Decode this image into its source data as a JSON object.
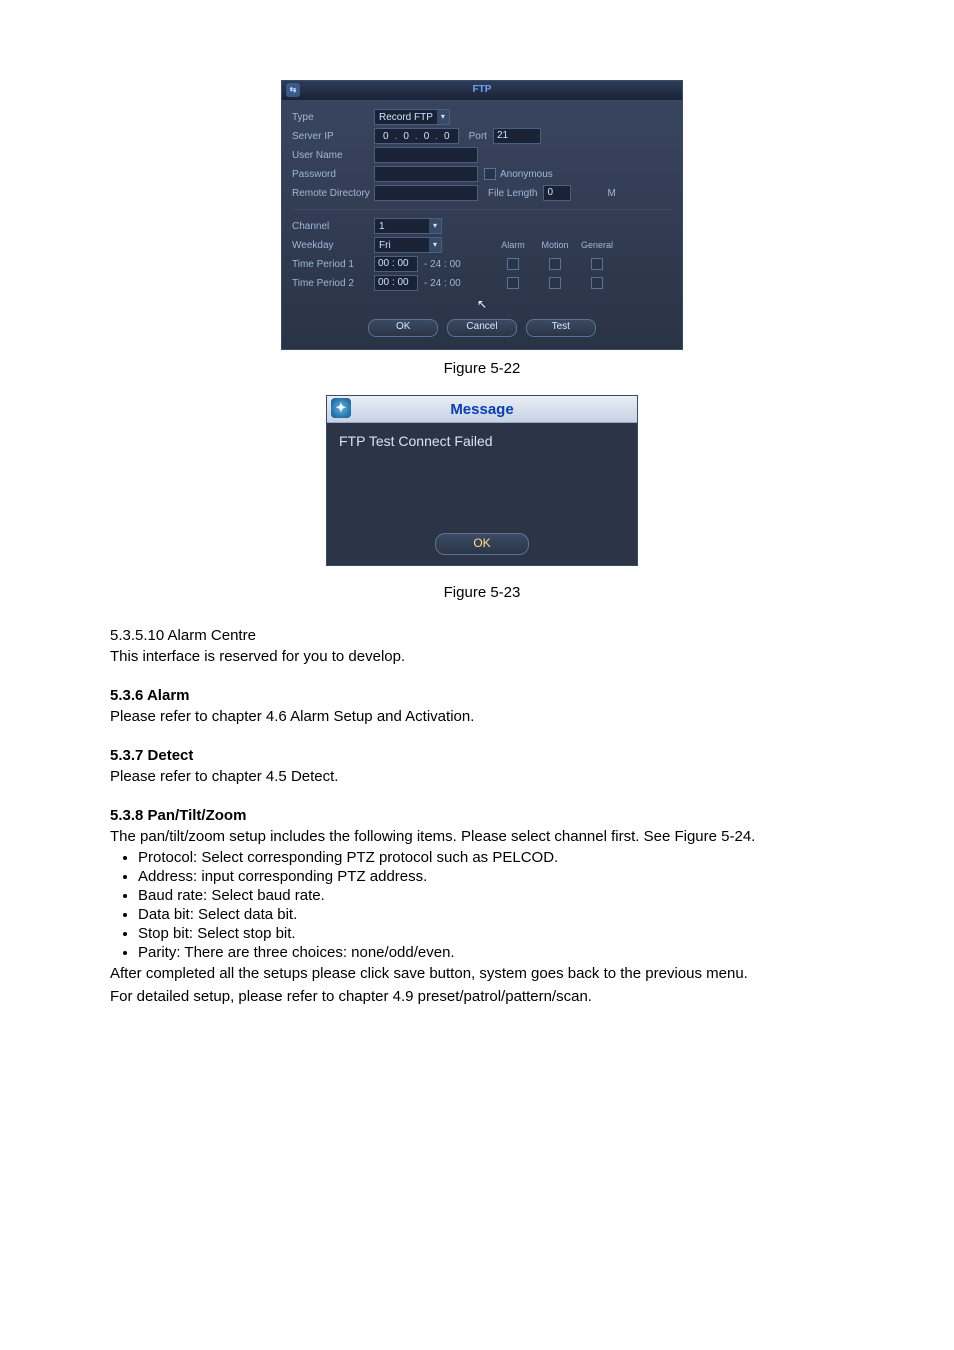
{
  "ftp": {
    "title": "FTP",
    "labels": {
      "type": "Type",
      "server_ip": "Server IP",
      "user_name": "User Name",
      "password": "Password",
      "remote_dir": "Remote Directory",
      "channel": "Channel",
      "weekday": "Weekday",
      "tp1": "Time Period 1",
      "tp2": "Time Period 2",
      "port": "Port",
      "anonymous": "Anonymous",
      "file_len": "File Length",
      "file_len_unit": "M",
      "col_alarm": "Alarm",
      "col_motion": "Motion",
      "col_general": "General"
    },
    "type_value": "Record FTP",
    "ip": [
      "0",
      "0",
      "0",
      "0"
    ],
    "port": "21",
    "file_length": "0",
    "channel": "1",
    "weekday": "Fri",
    "tp1_start": "00 : 00",
    "tp1_end": "- 24 : 00",
    "tp2_start": "00 : 00",
    "tp2_end": "- 24 : 00",
    "buttons": {
      "ok": "OK",
      "cancel": "Cancel",
      "test": "Test"
    }
  },
  "msg": {
    "title": "Message",
    "body": "FTP Test Connect Failed",
    "ok": "OK"
  },
  "captions": {
    "fig522": "Figure 5-22",
    "fig523": "Figure 5-23"
  },
  "sections": {
    "s53510_h": "5.3.5.10   Alarm Centre",
    "s53510_p": "This interface is reserved for you to develop.",
    "s536_h": "5.3.6  Alarm",
    "s536_p": "Please refer to chapter 4.6 Alarm Setup and Activation.",
    "s537_h": "5.3.7  Detect",
    "s537_p": "Please refer to chapter 4.5 Detect.",
    "s538_h": "5.3.8  Pan/Tilt/Zoom",
    "s538_p": "The pan/tilt/zoom setup includes the following items. Please select channel first. See Figure 5-24.",
    "bullets": {
      "b1": "Protocol: Select corresponding PTZ protocol such as PELCOD.",
      "b2": "Address: input corresponding PTZ address.",
      "b3": "Baud rate: Select baud rate.",
      "b4": "Data bit: Select data bit.",
      "b5": "Stop bit: Select stop bit.",
      "b6": "Parity: There are three choices: none/odd/even."
    },
    "after1": "After completed all the setups please click save button, system goes back to the previous menu.",
    "after2": "For detailed setup, please refer to chapter 4.9 preset/patrol/pattern/scan."
  }
}
